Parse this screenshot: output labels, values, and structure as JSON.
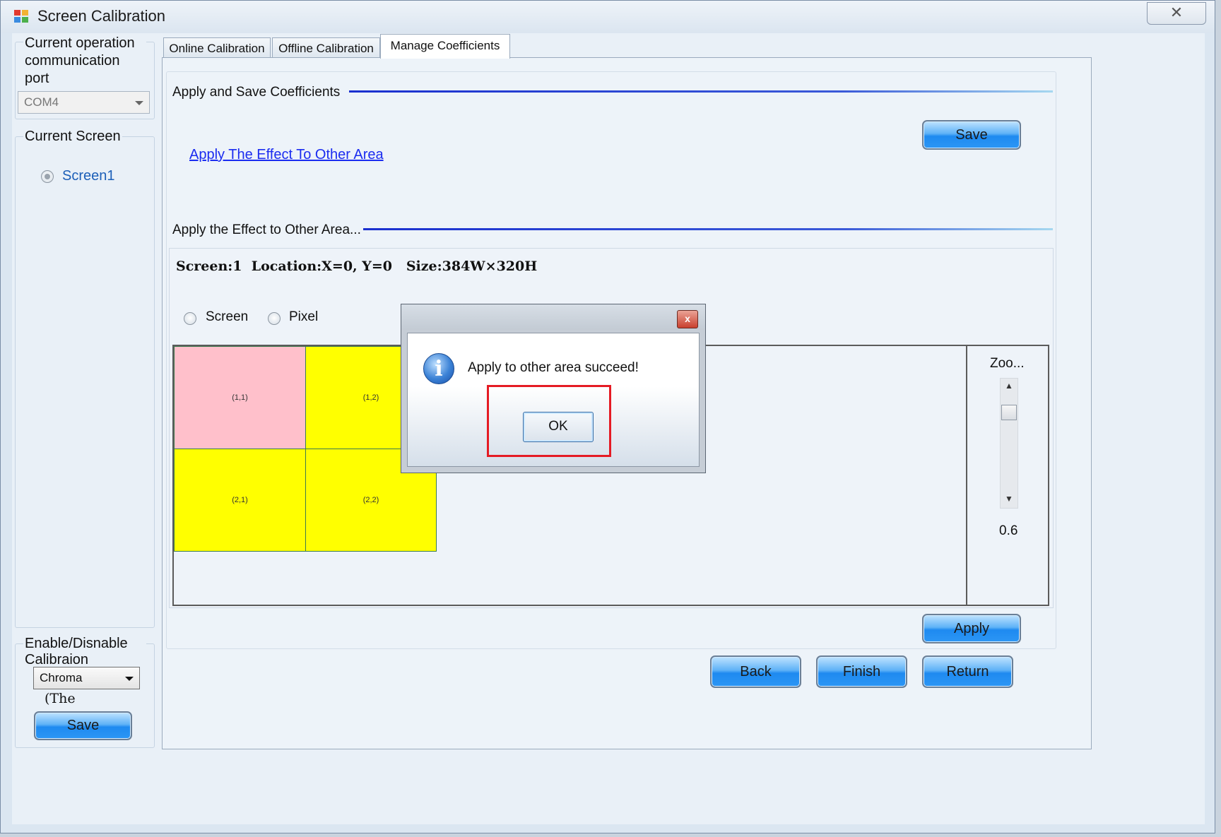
{
  "window": {
    "title": "Screen Calibration",
    "close_glyph": "✕"
  },
  "left_panel": {
    "comm_port_title": "Current operation communication port",
    "comm_port_value": "COM4",
    "current_screen_title": "Current Screen",
    "screens": [
      {
        "label": "Screen1",
        "checked": true
      }
    ],
    "calib_title": "Enable/Disnable Calibraion",
    "calib_mode": "Chroma",
    "calib_note": "(The",
    "save_label": "Save"
  },
  "tabs": [
    {
      "label": "Online Calibration",
      "active": false
    },
    {
      "label": "Offline Calibration",
      "active": false
    },
    {
      "label": "Manage Coefficients",
      "active": true
    }
  ],
  "manage": {
    "apply_save_title": "Apply and Save Coefficients",
    "save_label": "Save",
    "apply_effect_link": "Apply The Effect To Other Area",
    "apply_effect_title": "Apply the Effect to Other Area...",
    "info_text": "Screen:1  Location:X=0, Y=0   Size:384W×320H",
    "mode_options": [
      "Screen",
      "Pixel"
    ],
    "cells": [
      {
        "label": "(1,1)",
        "color": "#ffc0cb"
      },
      {
        "label": "(1,2)",
        "color": "#ffff00"
      },
      {
        "label": "(2,1)",
        "color": "#ffff00"
      },
      {
        "label": "(2,2)",
        "color": "#ffff00"
      }
    ],
    "zoom_label": "Zoo...",
    "zoom_value": "0.6",
    "apply_label": "Apply"
  },
  "nav": {
    "back_label": "Back",
    "finish_label": "Finish",
    "return_label": "Return"
  },
  "dialog": {
    "message": "Apply to other area succeed!",
    "ok_label": "OK",
    "close_glyph": "x",
    "highlight_color": "#e51b24"
  }
}
